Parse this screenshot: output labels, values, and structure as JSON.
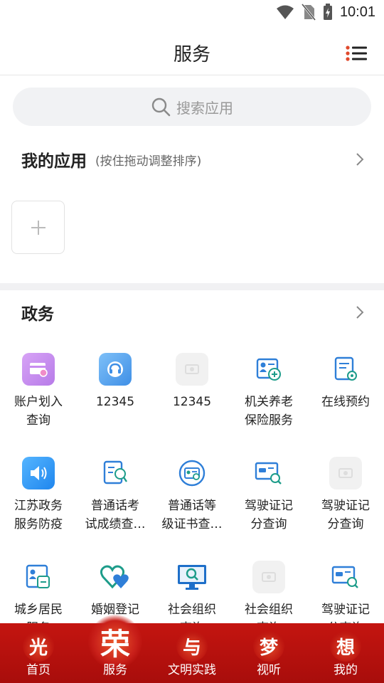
{
  "status_bar": {
    "time": "10:01"
  },
  "header": {
    "title": "服务"
  },
  "search": {
    "placeholder": "搜索应用"
  },
  "my_apps": {
    "title": "我的应用",
    "hint": "(按住拖动调整排序)"
  },
  "gov_section": {
    "title": "政务"
  },
  "apps": [
    {
      "label": "账户划入\n查询",
      "icon": "account-card-icon",
      "color": "#c98df0"
    },
    {
      "label": "12345",
      "icon": "hotline-headset-icon",
      "color": "#5aa9ee"
    },
    {
      "label": "12345",
      "icon": "placeholder-image-icon",
      "color": "#f1f1f1"
    },
    {
      "label": "机关养老\n保险服务",
      "icon": "pension-id-icon",
      "color": "#ffffff"
    },
    {
      "label": "在线预约",
      "icon": "appointment-doc-icon",
      "color": "#ffffff"
    },
    {
      "label": "江苏政务\n服务防疫",
      "icon": "speaker-icon",
      "color": "#2f9bf4"
    },
    {
      "label": "普通话考\n试成绩查…",
      "icon": "exam-score-icon",
      "color": "#ffffff"
    },
    {
      "label": "普通话等\n级证书查…",
      "icon": "certificate-search-icon",
      "color": "#ffffff"
    },
    {
      "label": "驾驶证记\n分查询",
      "icon": "license-search-icon",
      "color": "#ffffff"
    },
    {
      "label": "驾驶证记\n分查询",
      "icon": "placeholder-image-icon",
      "color": "#f1f1f1"
    },
    {
      "label": "城乡居民\n服务",
      "icon": "resident-id-icon",
      "color": "#ffffff"
    },
    {
      "label": "婚姻登记",
      "icon": "marriage-hearts-icon",
      "color": "#ffffff"
    },
    {
      "label": "社会组织\n查询",
      "icon": "monitor-search-icon",
      "color": "#ffffff"
    },
    {
      "label": "社会组织\n查询",
      "icon": "placeholder-image-icon",
      "color": "#f1f1f1"
    },
    {
      "label": "驾驶证记\n分查询",
      "icon": "license-search-icon",
      "color": "#ffffff"
    }
  ],
  "bottom_nav": [
    {
      "glyph": "光",
      "label": "首页"
    },
    {
      "glyph": "荣",
      "label": "服务"
    },
    {
      "glyph": "与",
      "label": "文明实践"
    },
    {
      "glyph": "梦",
      "label": "视听"
    },
    {
      "glyph": "想",
      "label": "我的"
    }
  ],
  "colors": {
    "accent_blue": "#2f7fd8",
    "nav_red": "#b8110e"
  }
}
